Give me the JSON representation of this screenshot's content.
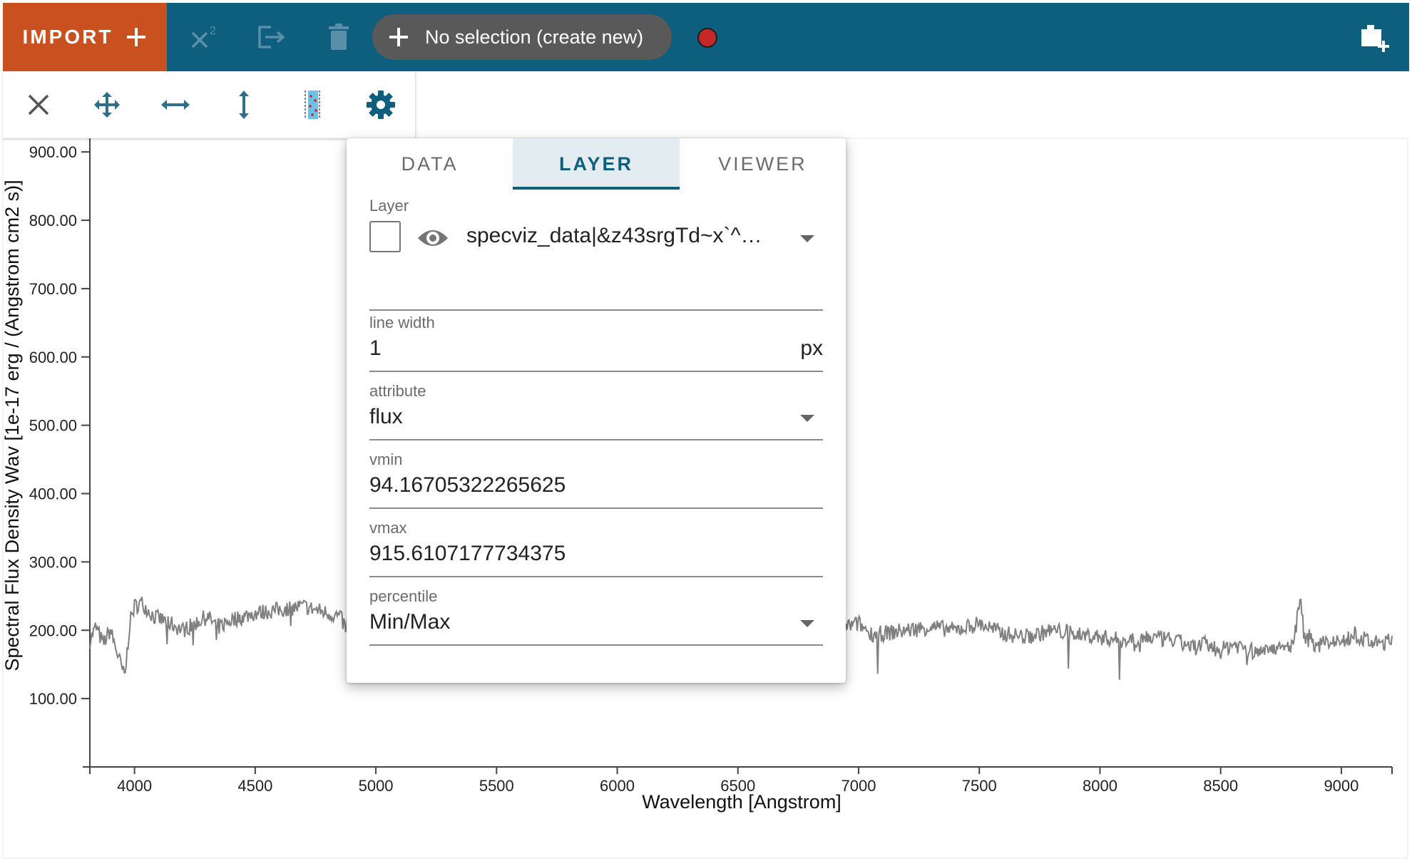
{
  "topbar": {
    "import_label": "IMPORT",
    "subset_label": "No selection (create new)",
    "accent_color": "#0e5e7e",
    "import_color": "#c8511f"
  },
  "toolbar": {
    "icons": [
      "close-icon",
      "pan-zoom-icon",
      "zoom-x-icon",
      "zoom-y-icon",
      "range-select-icon",
      "gear-icon"
    ]
  },
  "plot": {
    "y_tick_labels": [
      "900.00",
      "800.00",
      "700.00",
      "600.00",
      "500.00",
      "400.00",
      "300.00",
      "200.00",
      "100.00"
    ],
    "x_tick_labels": [
      "4000",
      "4500",
      "5000",
      "5500",
      "6000",
      "6500",
      "7000",
      "7500",
      "8000",
      "8500",
      "9000"
    ],
    "xlabel": "Wavelength [Angstrom]",
    "ylabel": "Spectral Flux Density Wav [1e-17 erg / (Angstrom cm2 s)]"
  },
  "chart_data": {
    "type": "line",
    "xlabel": "Wavelength [Angstrom]",
    "ylabel": "Spectral Flux Density Wav [1e-17 erg / (Angstrom cm2 s)]",
    "xlim": [
      3815,
      9210
    ],
    "ylim": [
      0,
      920
    ],
    "x_ticks": [
      4000,
      4500,
      5000,
      5500,
      6000,
      6500,
      7000,
      7500,
      8000,
      8500,
      9000
    ],
    "y_ticks": [
      100,
      200,
      300,
      400,
      500,
      600,
      700,
      800,
      900
    ],
    "grid": false,
    "series": [
      {
        "color": "#808080",
        "x": [
          3815,
          3840,
          3870,
          3900,
          3930,
          3960,
          3980,
          4000,
          4030,
          4080,
          4150,
          4200,
          4300,
          4350,
          4400,
          4500,
          4600,
          4700,
          4800,
          4850,
          4880,
          4885,
          4890,
          4900,
          4950,
          5000,
          5100,
          5200,
          5300,
          5400,
          5500,
          5600,
          5700,
          5800,
          5900,
          6000,
          6100,
          6200,
          6300,
          6400,
          6500,
          6600,
          6700,
          6800,
          6900,
          6950,
          7000,
          7050,
          7100,
          7200,
          7300,
          7400,
          7500,
          7600,
          7700,
          7800,
          7900,
          8000,
          8100,
          8200,
          8300,
          8400,
          8430,
          8500,
          8550,
          8600,
          8650,
          8700,
          8750,
          8800,
          8830,
          8850,
          8870,
          8900,
          8950,
          9000,
          9050,
          9100,
          9150,
          9210
        ],
        "y": [
          185,
          205,
          180,
          200,
          165,
          130,
          210,
          235,
          240,
          220,
          210,
          200,
          220,
          205,
          215,
          225,
          230,
          235,
          225,
          220,
          200,
          235,
          225,
          215,
          220,
          210,
          215,
          212,
          210,
          205,
          210,
          208,
          205,
          210,
          205,
          210,
          205,
          208,
          205,
          210,
          205,
          208,
          205,
          210,
          208,
          205,
          210,
          195,
          195,
          200,
          205,
          200,
          210,
          195,
          190,
          200,
          195,
          190,
          185,
          190,
          185,
          175,
          180,
          170,
          180,
          175,
          165,
          180,
          170,
          180,
          245,
          180,
          190,
          175,
          185,
          180,
          195,
          185,
          180,
          185
        ]
      }
    ]
  },
  "panel": {
    "tabs": [
      "DATA",
      "LAYER",
      "VIEWER"
    ],
    "active_tab": "LAYER",
    "layer_label": "Layer",
    "layer_value": "specviz_data|&z43srgTd~x`^…",
    "line_width_label": "line width",
    "line_width_value": "1",
    "line_width_unit": "px",
    "attribute_label": "attribute",
    "attribute_value": "flux",
    "vmin_label": "vmin",
    "vmin_value": "94.16705322265625",
    "vmax_label": "vmax",
    "vmax_value": "915.6107177734375",
    "percentile_label": "percentile",
    "percentile_value": "Min/Max"
  }
}
